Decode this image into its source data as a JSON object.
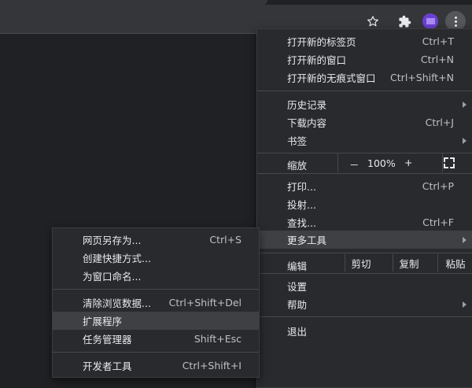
{
  "toolbar": {
    "icons": [
      "star-icon",
      "puzzle-icon",
      "avatar",
      "more-vert-icon"
    ]
  },
  "main_menu": {
    "new_tab": {
      "label": "打开新的标签页",
      "shortcut": "Ctrl+T"
    },
    "new_window": {
      "label": "打开新的窗口",
      "shortcut": "Ctrl+N"
    },
    "new_incognito": {
      "label": "打开新的无痕式窗口",
      "shortcut": "Ctrl+Shift+N"
    },
    "history": {
      "label": "历史记录"
    },
    "downloads": {
      "label": "下载内容",
      "shortcut": "Ctrl+J"
    },
    "bookmarks": {
      "label": "书签"
    },
    "zoom": {
      "label": "缩放",
      "minus": "－",
      "value": "100%",
      "plus": "+"
    },
    "print": {
      "label": "打印...",
      "shortcut": "Ctrl+P"
    },
    "cast": {
      "label": "投射..."
    },
    "find": {
      "label": "查找...",
      "shortcut": "Ctrl+F"
    },
    "more_tools": {
      "label": "更多工具"
    },
    "edit": {
      "label": "编辑",
      "cut": "剪切",
      "copy": "复制",
      "paste": "粘贴"
    },
    "settings": {
      "label": "设置"
    },
    "help": {
      "label": "帮助"
    },
    "exit": {
      "label": "退出"
    }
  },
  "sub_menu": {
    "save_page": {
      "label": "网页另存为...",
      "shortcut": "Ctrl+S"
    },
    "create_shortcut": {
      "label": "创建快捷方式..."
    },
    "name_window": {
      "label": "为窗口命名..."
    },
    "clear_data": {
      "label": "清除浏览数据...",
      "shortcut": "Ctrl+Shift+Del"
    },
    "extensions": {
      "label": "扩展程序"
    },
    "task_manager": {
      "label": "任务管理器",
      "shortcut": "Shift+Esc"
    },
    "dev_tools": {
      "label": "开发者工具",
      "shortcut": "Ctrl+Shift+I"
    }
  },
  "colors": {
    "background": "#202124",
    "toolbar": "#35363a",
    "menu": "#292a2d",
    "highlight": "#3f4043",
    "text": "#e8eaed",
    "avatar": "#6a3fd0"
  }
}
